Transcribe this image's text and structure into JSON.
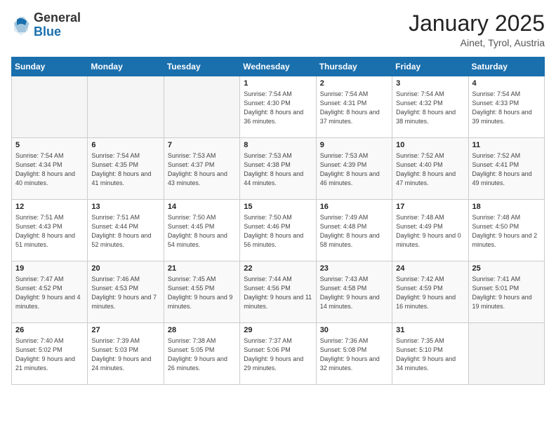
{
  "header": {
    "logo_line1": "General",
    "logo_line2": "Blue",
    "month_title": "January 2025",
    "location": "Ainet, Tyrol, Austria"
  },
  "days_of_week": [
    "Sunday",
    "Monday",
    "Tuesday",
    "Wednesday",
    "Thursday",
    "Friday",
    "Saturday"
  ],
  "weeks": [
    [
      {
        "day": "",
        "info": ""
      },
      {
        "day": "",
        "info": ""
      },
      {
        "day": "",
        "info": ""
      },
      {
        "day": "1",
        "info": "Sunrise: 7:54 AM\nSunset: 4:30 PM\nDaylight: 8 hours and 36 minutes."
      },
      {
        "day": "2",
        "info": "Sunrise: 7:54 AM\nSunset: 4:31 PM\nDaylight: 8 hours and 37 minutes."
      },
      {
        "day": "3",
        "info": "Sunrise: 7:54 AM\nSunset: 4:32 PM\nDaylight: 8 hours and 38 minutes."
      },
      {
        "day": "4",
        "info": "Sunrise: 7:54 AM\nSunset: 4:33 PM\nDaylight: 8 hours and 39 minutes."
      }
    ],
    [
      {
        "day": "5",
        "info": "Sunrise: 7:54 AM\nSunset: 4:34 PM\nDaylight: 8 hours and 40 minutes."
      },
      {
        "day": "6",
        "info": "Sunrise: 7:54 AM\nSunset: 4:35 PM\nDaylight: 8 hours and 41 minutes."
      },
      {
        "day": "7",
        "info": "Sunrise: 7:53 AM\nSunset: 4:37 PM\nDaylight: 8 hours and 43 minutes."
      },
      {
        "day": "8",
        "info": "Sunrise: 7:53 AM\nSunset: 4:38 PM\nDaylight: 8 hours and 44 minutes."
      },
      {
        "day": "9",
        "info": "Sunrise: 7:53 AM\nSunset: 4:39 PM\nDaylight: 8 hours and 46 minutes."
      },
      {
        "day": "10",
        "info": "Sunrise: 7:52 AM\nSunset: 4:40 PM\nDaylight: 8 hours and 47 minutes."
      },
      {
        "day": "11",
        "info": "Sunrise: 7:52 AM\nSunset: 4:41 PM\nDaylight: 8 hours and 49 minutes."
      }
    ],
    [
      {
        "day": "12",
        "info": "Sunrise: 7:51 AM\nSunset: 4:43 PM\nDaylight: 8 hours and 51 minutes."
      },
      {
        "day": "13",
        "info": "Sunrise: 7:51 AM\nSunset: 4:44 PM\nDaylight: 8 hours and 52 minutes."
      },
      {
        "day": "14",
        "info": "Sunrise: 7:50 AM\nSunset: 4:45 PM\nDaylight: 8 hours and 54 minutes."
      },
      {
        "day": "15",
        "info": "Sunrise: 7:50 AM\nSunset: 4:46 PM\nDaylight: 8 hours and 56 minutes."
      },
      {
        "day": "16",
        "info": "Sunrise: 7:49 AM\nSunset: 4:48 PM\nDaylight: 8 hours and 58 minutes."
      },
      {
        "day": "17",
        "info": "Sunrise: 7:48 AM\nSunset: 4:49 PM\nDaylight: 9 hours and 0 minutes."
      },
      {
        "day": "18",
        "info": "Sunrise: 7:48 AM\nSunset: 4:50 PM\nDaylight: 9 hours and 2 minutes."
      }
    ],
    [
      {
        "day": "19",
        "info": "Sunrise: 7:47 AM\nSunset: 4:52 PM\nDaylight: 9 hours and 4 minutes."
      },
      {
        "day": "20",
        "info": "Sunrise: 7:46 AM\nSunset: 4:53 PM\nDaylight: 9 hours and 7 minutes."
      },
      {
        "day": "21",
        "info": "Sunrise: 7:45 AM\nSunset: 4:55 PM\nDaylight: 9 hours and 9 minutes."
      },
      {
        "day": "22",
        "info": "Sunrise: 7:44 AM\nSunset: 4:56 PM\nDaylight: 9 hours and 11 minutes."
      },
      {
        "day": "23",
        "info": "Sunrise: 7:43 AM\nSunset: 4:58 PM\nDaylight: 9 hours and 14 minutes."
      },
      {
        "day": "24",
        "info": "Sunrise: 7:42 AM\nSunset: 4:59 PM\nDaylight: 9 hours and 16 minutes."
      },
      {
        "day": "25",
        "info": "Sunrise: 7:41 AM\nSunset: 5:01 PM\nDaylight: 9 hours and 19 minutes."
      }
    ],
    [
      {
        "day": "26",
        "info": "Sunrise: 7:40 AM\nSunset: 5:02 PM\nDaylight: 9 hours and 21 minutes."
      },
      {
        "day": "27",
        "info": "Sunrise: 7:39 AM\nSunset: 5:03 PM\nDaylight: 9 hours and 24 minutes."
      },
      {
        "day": "28",
        "info": "Sunrise: 7:38 AM\nSunset: 5:05 PM\nDaylight: 9 hours and 26 minutes."
      },
      {
        "day": "29",
        "info": "Sunrise: 7:37 AM\nSunset: 5:06 PM\nDaylight: 9 hours and 29 minutes."
      },
      {
        "day": "30",
        "info": "Sunrise: 7:36 AM\nSunset: 5:08 PM\nDaylight: 9 hours and 32 minutes."
      },
      {
        "day": "31",
        "info": "Sunrise: 7:35 AM\nSunset: 5:10 PM\nDaylight: 9 hours and 34 minutes."
      },
      {
        "day": "",
        "info": ""
      }
    ]
  ]
}
